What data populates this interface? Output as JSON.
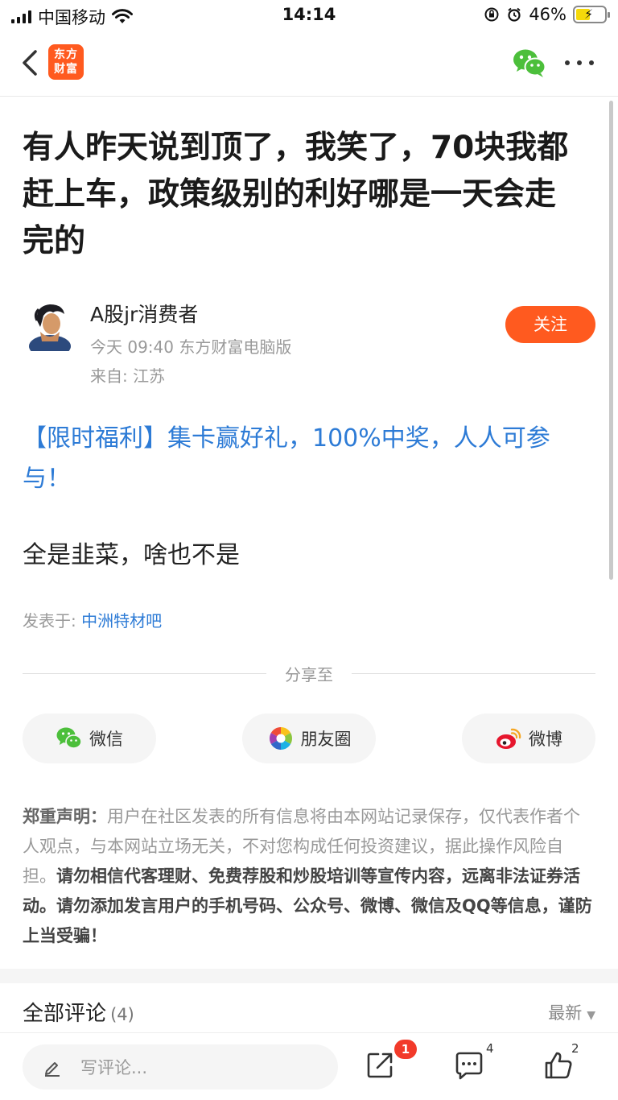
{
  "status_bar": {
    "carrier": "中国移动",
    "time": "14:14",
    "battery": "46%"
  },
  "nav": {
    "logo_line1": "东方",
    "logo_line2": "财富"
  },
  "article": {
    "title": "有人昨天说到顶了，我笑了，70块我都赶上车，政策级别的利好哪是一天会走完的",
    "author": {
      "name": "A股jr消费者",
      "meta": "今天 09:40 东方财富电脑版",
      "location": "来自: 江苏",
      "follow_label": "关注"
    },
    "promo": "【限时福利】集卡赢好礼，100%中奖，人人可参与！",
    "body": "全是韭菜，啥也不是",
    "posted_in_label": "发表于:",
    "forum": "中洲特材吧"
  },
  "share": {
    "label": "分享至",
    "buttons": [
      {
        "label": "微信",
        "icon": "wechat-icon"
      },
      {
        "label": "朋友圈",
        "icon": "moments-icon"
      },
      {
        "label": "微博",
        "icon": "weibo-icon"
      }
    ]
  },
  "disclaimer": {
    "label": "郑重声明：",
    "normal": "用户在社区发表的所有信息将由本网站记录保存，仅代表作者个人观点，与本网站立场无关，不对您构成任何投资建议，据此操作风险自担。",
    "bold": "请勿相信代客理财、免费荐股和炒股培训等宣传内容，远离非法证券活动。请勿添加发言用户的手机号码、公众号、微博、微信及QQ等信息，谨防上当受骗！"
  },
  "comments": {
    "title": "全部评论",
    "count": "(4)",
    "sort": "最新"
  },
  "bottom_bar": {
    "input_placeholder": "写评论...",
    "share_badge": "1",
    "comment_count": "4",
    "like_count": "2"
  },
  "colors": {
    "accent": "#ff5a1f",
    "link": "#2d7bd6",
    "badge": "#f23a2a"
  }
}
